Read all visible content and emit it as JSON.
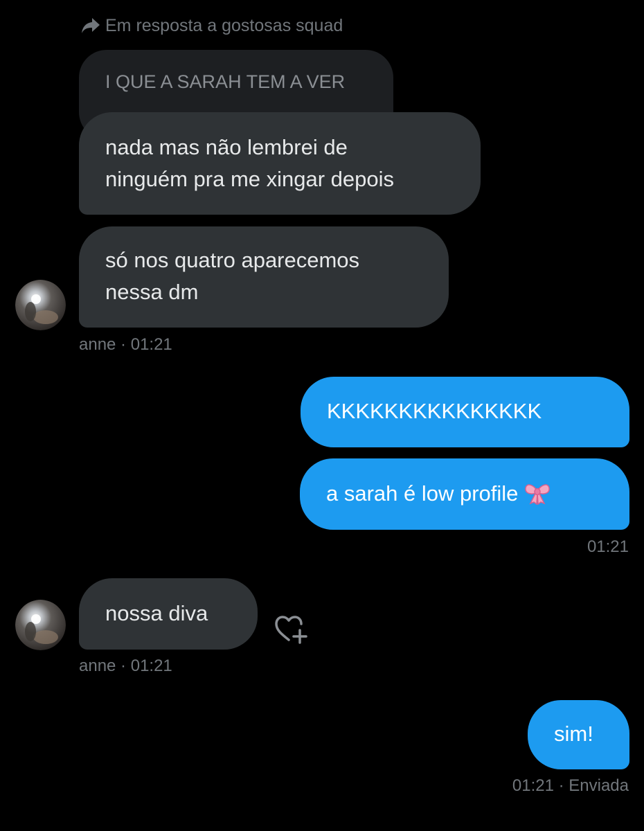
{
  "reply_header": {
    "icon": "reply-arrow-icon",
    "text": "Em resposta a gostosas squad"
  },
  "quoted_message": {
    "text": "I QUE A SARAH TEM A VER"
  },
  "received_group_1": {
    "messages": [
      {
        "line1": "nada mas não lembrei de",
        "line2": "ninguém pra me xingar depois"
      },
      {
        "line1": "só nos quatro aparecemos",
        "line2": "nessa dm"
      }
    ],
    "sender": "anne",
    "time": "01:21"
  },
  "sent_group_1": {
    "messages": [
      {
        "text": "KKKKKKKKKKKKKKK"
      },
      {
        "text": "a sarah é low profile",
        "emoji": "ribbon-emoji"
      }
    ],
    "time": "01:21"
  },
  "received_group_2": {
    "messages": [
      {
        "text": "nossa diva"
      }
    ],
    "sender": "anne",
    "time": "01:21",
    "reaction_icon": "add-reaction-heart-icon"
  },
  "sent_group_2": {
    "messages": [
      {
        "text": "sim!"
      }
    ],
    "time": "01:21",
    "status": "Enviada"
  },
  "separator": " · ",
  "colors": {
    "background": "#000000",
    "incoming_bubble": "#2f3336",
    "outgoing_bubble": "#1d9bf0",
    "meta_text": "#71767b"
  }
}
